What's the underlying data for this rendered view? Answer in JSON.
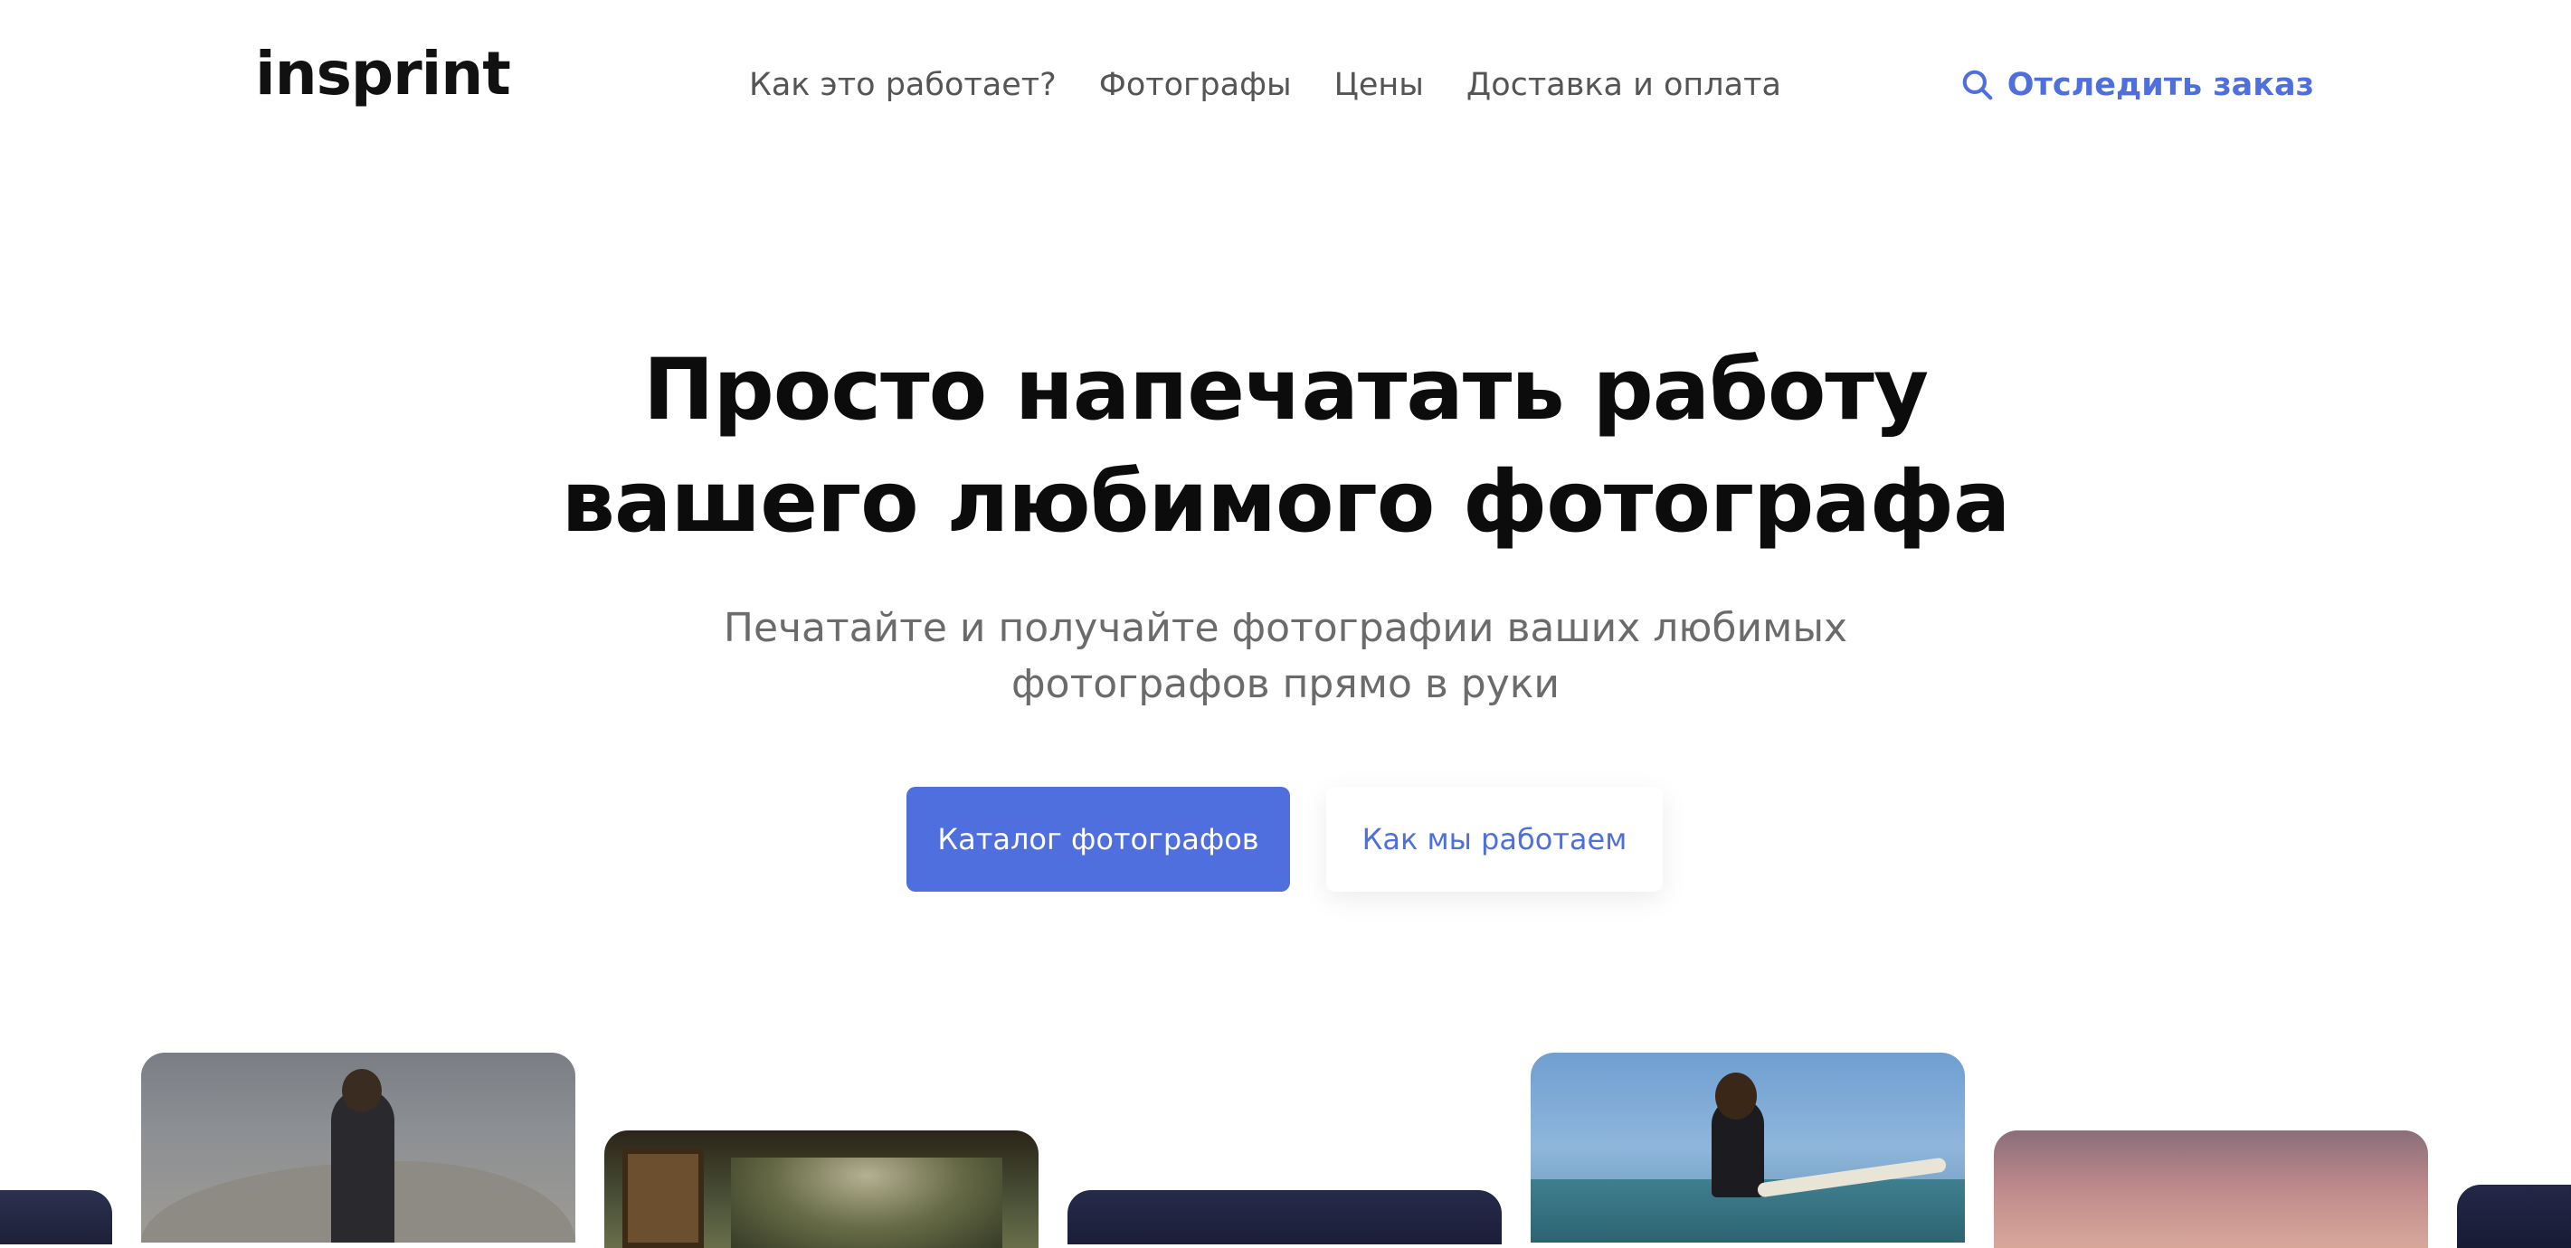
{
  "header": {
    "logo_text": "insprint",
    "nav": [
      {
        "label": "Как это работает?"
      },
      {
        "label": "Фотографы"
      },
      {
        "label": "Цены"
      },
      {
        "label": "Доставка и оплата"
      }
    ],
    "track_order_label": "Отследить заказ",
    "track_order_icon": "search-icon"
  },
  "hero": {
    "title_line1": "Просто напечатать работу",
    "title_line2": "вашего любимого фотографа",
    "subtitle_line1": "Печатайте и получайте фотографии ваших любимых",
    "subtitle_line2": "фотографов прямо в руки",
    "primary_button": "Каталог фотографов",
    "secondary_button": "Как мы работаем"
  },
  "colors": {
    "accent": "#4f6fde",
    "text_dark": "#0c0c0c",
    "text_muted": "#6b6b6b",
    "background": "#ffffff"
  }
}
